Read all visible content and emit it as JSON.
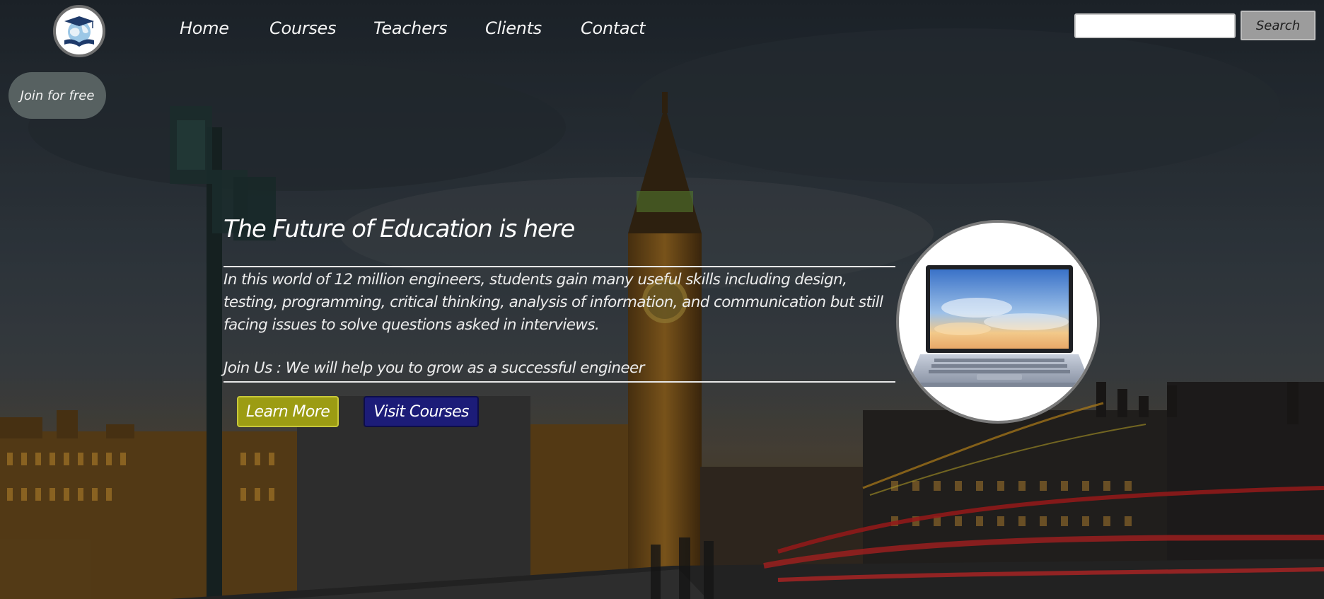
{
  "nav": {
    "items": [
      {
        "label": "Home"
      },
      {
        "label": "Courses"
      },
      {
        "label": "Teachers"
      },
      {
        "label": "Clients"
      },
      {
        "label": "Contact"
      }
    ]
  },
  "join_button": {
    "label": "Join for free"
  },
  "search": {
    "placeholder": "",
    "value": "",
    "button_label": "Search"
  },
  "hero": {
    "title": "The Future of Education is here",
    "description": "In this world of 12 million engineers, students gain many useful skills including design, testing, programming, critical thinking, analysis of information, and communication but still facing issues to solve questions asked in interviews.",
    "join_text": "Join Us : We will help you to grow as a successful engineer",
    "learn_more_label": "Learn More",
    "visit_courses_label": "Visit Courses"
  },
  "icons": {
    "logo": "graduation-cap-globe-book-icon",
    "laptop": "laptop-image"
  },
  "colors": {
    "learn_more_bg": "#9c9c13",
    "visit_courses_bg": "#1c1c78",
    "join_button_bg": "#5c6666",
    "search_button_bg": "#9c9c9c",
    "text": "#ffffff"
  }
}
